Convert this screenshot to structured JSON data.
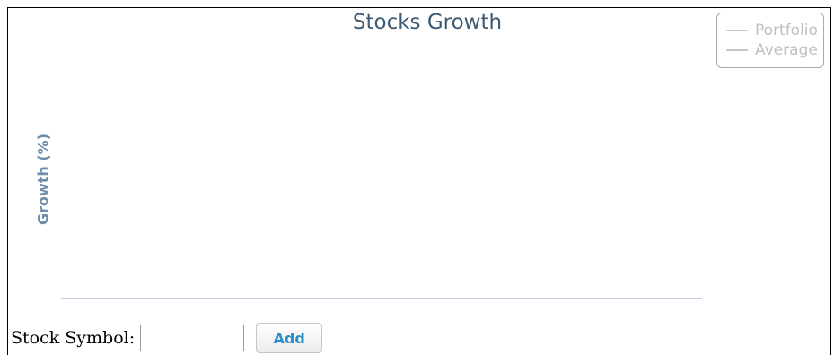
{
  "chart_data": {
    "type": "line",
    "title": "Stocks Growth",
    "ylabel": "Growth (%)",
    "xlabel": "",
    "series": [
      {
        "name": "Portfolio",
        "values": []
      },
      {
        "name": "Average",
        "values": []
      }
    ],
    "legend_placement": "top-right"
  },
  "controls": {
    "symbol_label": "Stock Symbol:",
    "symbol_value": "",
    "add_label": "Add"
  },
  "colors": {
    "title": "#3e5a72",
    "axis_label": "#6f8eab",
    "legend_inactive": "#c0c0c0",
    "button_text": "#2b8ec9"
  }
}
